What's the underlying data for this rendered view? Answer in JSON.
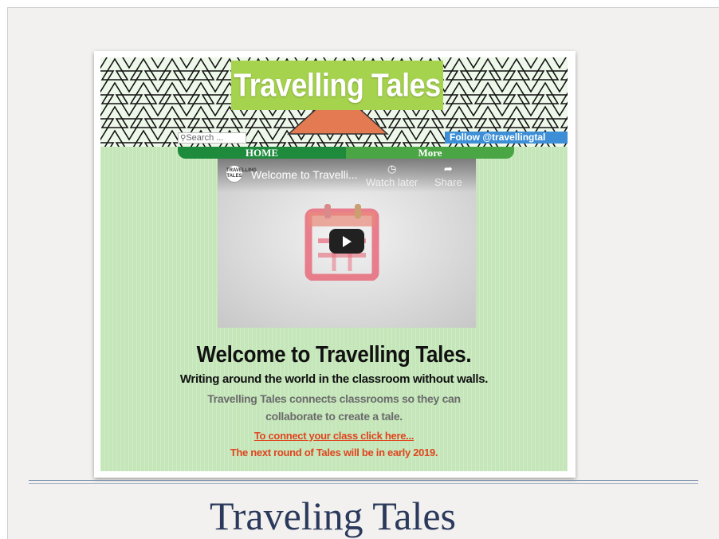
{
  "site": {
    "title": "Travelling Tales",
    "search_placeholder": "Search ...",
    "follow_label": "Follow @travellingtal",
    "nav": {
      "home": "HOME",
      "more": "More"
    }
  },
  "video": {
    "channel_logo": "TRAVELLING TALES",
    "title": "Welcome to Travelli...",
    "watch_later": "Watch later",
    "share": "Share"
  },
  "content": {
    "heading": "Welcome to Travelling Tales.",
    "subtitle": "Writing around the world in the classroom without walls.",
    "description": "Travelling Tales connects classrooms so they can collaborate to create a tale.",
    "connect_link": "To connect your class click here...",
    "next_round": "The next round of Tales will be in early 2019."
  },
  "slide": {
    "title": "Traveling Tales"
  },
  "colors": {
    "title_bg": "#a6d34e",
    "nav_home": "#1e8a3c",
    "nav_more": "#4aa544",
    "site_bg": "#c4e6b9",
    "accent_red": "#e0441f",
    "slide_title": "#2b3a5c"
  }
}
